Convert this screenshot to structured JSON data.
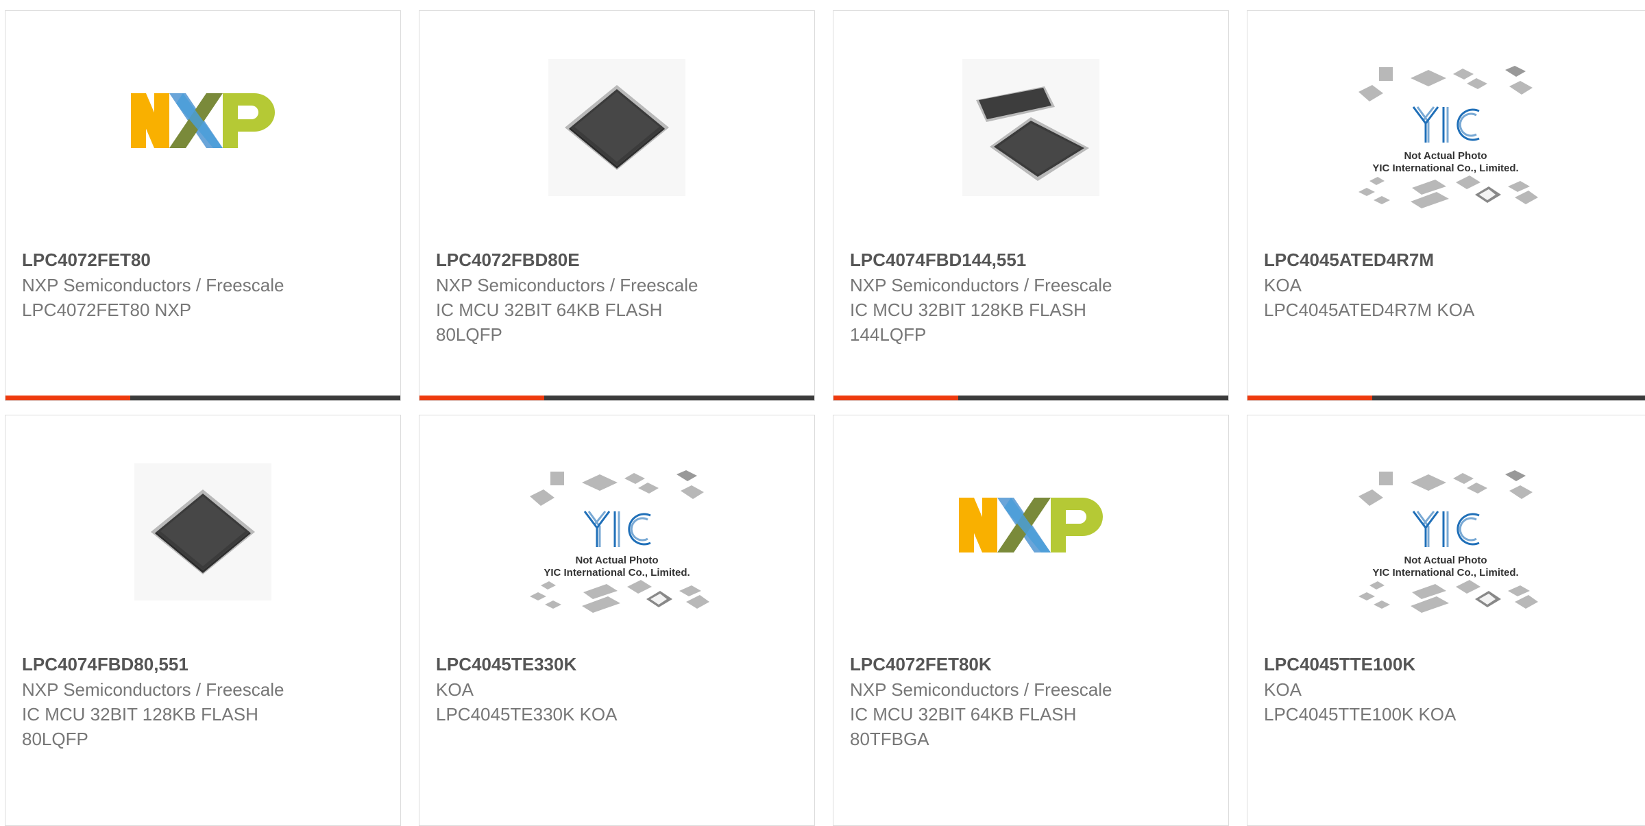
{
  "colors": {
    "accent": "#ee3a0e",
    "bar": "#3b3b3b",
    "card_border": "#dcdcdc",
    "title": "#555555",
    "text": "#777777"
  },
  "yic": {
    "line1": "Not Actual Photo",
    "line2": "YIC International Co., Limited."
  },
  "products": [
    {
      "part_number": "LPC4072FET80",
      "manufacturer": "NXP Semiconductors / Freescale",
      "description": "LPC4072FET80 NXP",
      "image": "nxp-logo"
    },
    {
      "part_number": "LPC4072FBD80E",
      "manufacturer": "NXP Semiconductors / Freescale",
      "description": "IC MCU 32BIT 64KB FLASH 80LQFP",
      "image": "lqfp-chip"
    },
    {
      "part_number": "LPC4074FBD144,551",
      "manufacturer": "NXP Semiconductors / Freescale",
      "description": "IC MCU 32BIT 128KB FLASH 144LQFP",
      "image": "lqfp-chip-pair"
    },
    {
      "part_number": "LPC4045ATED4R7M",
      "manufacturer": "KOA",
      "description": "LPC4045ATED4R7M KOA",
      "image": "yic-placeholder"
    },
    {
      "part_number": "LPC4074FBD80,551",
      "manufacturer": "NXP Semiconductors / Freescale",
      "description": "IC MCU 32BIT 128KB FLASH 80LQFP",
      "image": "lqfp-chip"
    },
    {
      "part_number": "LPC4045TE330K",
      "manufacturer": "KOA",
      "description": "LPC4045TE330K KOA",
      "image": "yic-placeholder"
    },
    {
      "part_number": "LPC4072FET80K",
      "manufacturer": "NXP Semiconductors / Freescale",
      "description": "IC MCU 32BIT 64KB FLASH 80TFBGA",
      "image": "nxp-logo"
    },
    {
      "part_number": "LPC4045TTE100K",
      "manufacturer": "KOA",
      "description": "LPC4045TTE100K KOA",
      "image": "yic-placeholder"
    }
  ]
}
